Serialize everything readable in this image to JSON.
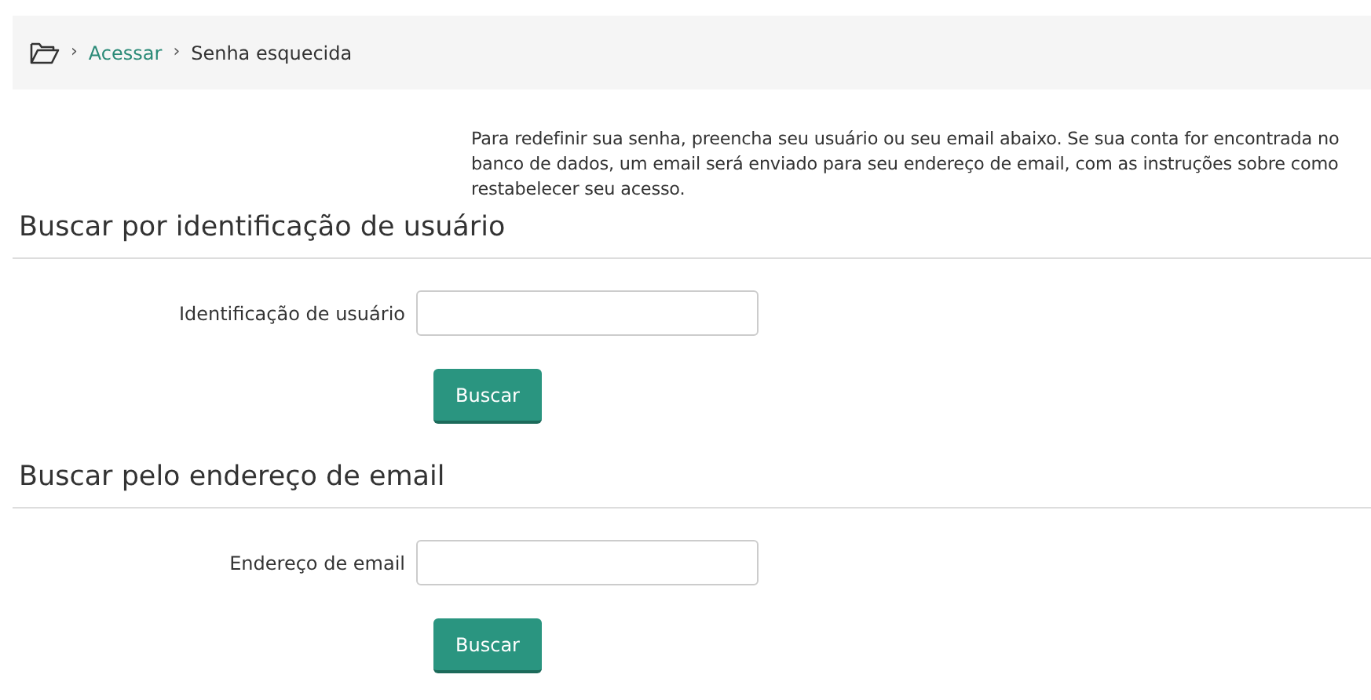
{
  "breadcrumb": [
    {
      "separator": "›",
      "label": "Acessar",
      "link": true
    },
    {
      "separator": "›",
      "label": "Senha esquecida",
      "link": false
    }
  ],
  "intro": "Para redefinir sua senha, preencha seu usuário ou seu email abaixo. Se sua conta for encontrada no banco de dados, um email será enviado para seu endereço de email, com as instruções sobre como restabelecer seu acesso.",
  "sections": [
    {
      "heading": "Buscar por identificação de usuário",
      "label": "Identificação de usuário",
      "button": "Buscar"
    },
    {
      "heading": "Buscar pelo endereço de email",
      "label": "Endereço de email",
      "button": "Buscar"
    }
  ]
}
